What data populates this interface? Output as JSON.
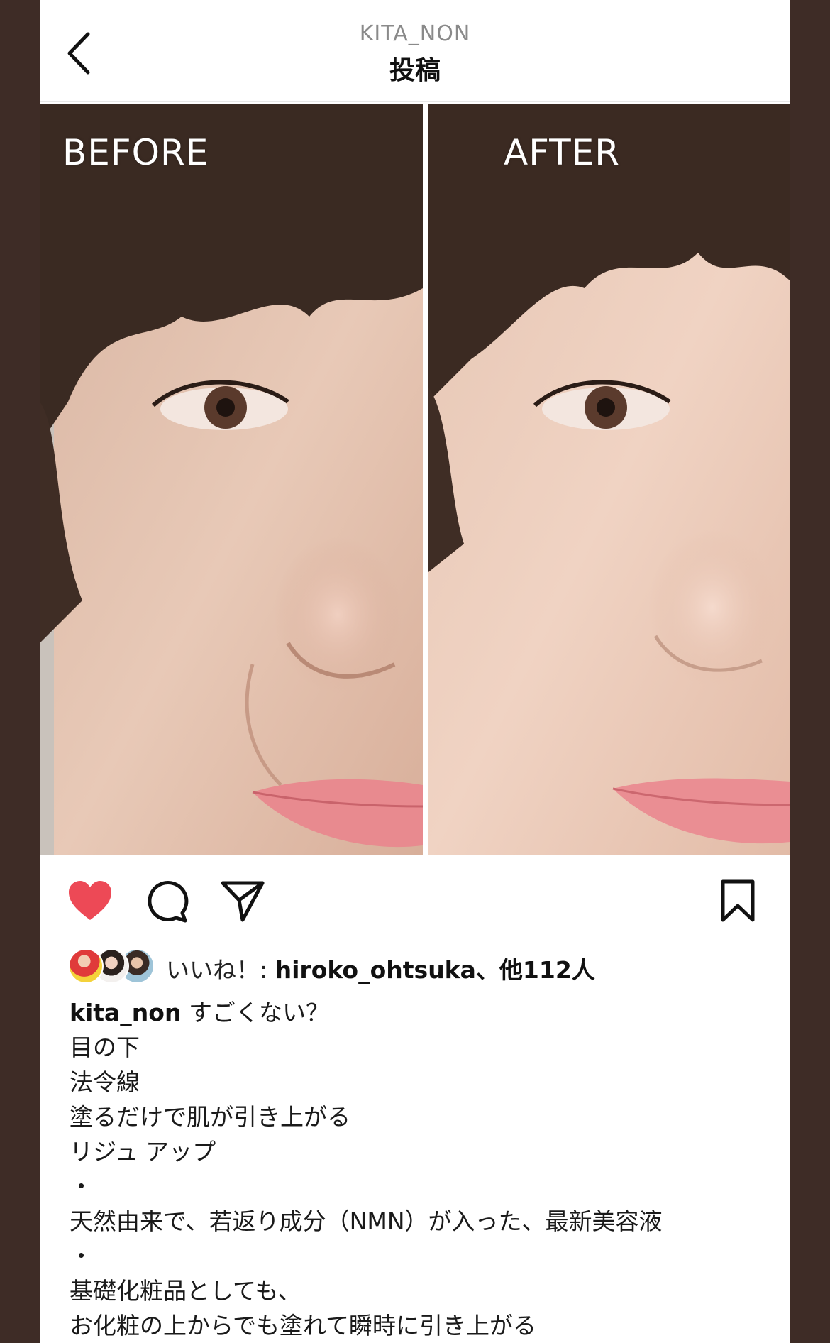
{
  "header": {
    "username": "KITA_NON",
    "title": "投稿"
  },
  "photo": {
    "before_label": "BEFORE",
    "after_label": "AFTER"
  },
  "likes": {
    "prefix": "いいね！:",
    "user": "hiroko_ohtsuka",
    "suffix": "、他112人",
    "liked": true
  },
  "caption": {
    "username": "kita_non",
    "lines": [
      "すごくない？",
      "目の下",
      "法令線",
      "塗るだけで肌が引き上がる",
      "リジュ アップ",
      "・",
      "天然由来で、若返り成分（NMN）が入った、最新美容液",
      "・",
      "基礎化粧品としても、",
      "お化粧の上からでも塗れて瞬時に引き上がる"
    ]
  },
  "icons": {
    "back": "chevron-left-icon",
    "like": "heart-icon",
    "comment": "comment-icon",
    "share": "send-icon",
    "save": "bookmark-icon"
  },
  "colors": {
    "heart": "#ed4956",
    "background": "#3e2c26"
  }
}
